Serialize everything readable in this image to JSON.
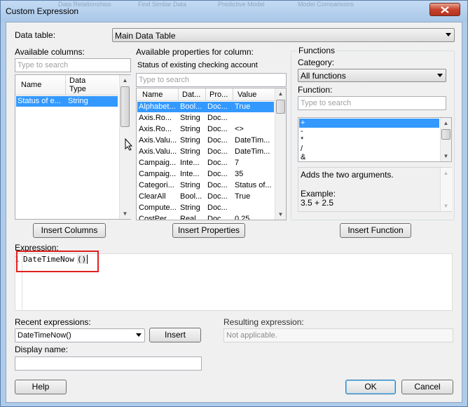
{
  "window": {
    "title": "Custom Expression",
    "ghost_menu_items": [
      "Data Relationships",
      "Find Similar Data",
      "Predictive Model",
      "Model Comparisons"
    ]
  },
  "data_table": {
    "label": "Data table:",
    "value": "Main Data Table"
  },
  "columns": {
    "label": "Available columns:",
    "search_placeholder": "Type to search",
    "headers": [
      "Name",
      "Data Type"
    ],
    "header_type_line1": "Data",
    "header_type_line2": "Type",
    "rows": [
      {
        "name": "Status of e...",
        "type": "String"
      }
    ],
    "insert_label": "Insert Columns"
  },
  "properties": {
    "label": "Available properties for column:",
    "column_name": "Status of existing checking account",
    "search_placeholder": "Type to search",
    "headers": [
      "Name",
      "Dat...",
      "Pro...",
      "Value"
    ],
    "rows": [
      [
        "Alphabet...",
        "Bool...",
        "Doc...",
        "True"
      ],
      [
        "Axis.Ro...",
        "String",
        "Doc...",
        ""
      ],
      [
        "Axis.Ro...",
        "String",
        "Doc...",
        "<>"
      ],
      [
        "Axis.Valu...",
        "String",
        "Doc...",
        "DateTim..."
      ],
      [
        "Axis.Valu...",
        "String",
        "Doc...",
        "DateTim..."
      ],
      [
        "Campaig...",
        "Inte...",
        "Doc...",
        "7"
      ],
      [
        "Campaig...",
        "Inte...",
        "Doc...",
        "35"
      ],
      [
        "Categori...",
        "String",
        "Doc...",
        "Status of..."
      ],
      [
        "ClearAll",
        "Bool...",
        "Doc...",
        "True"
      ],
      [
        "Compute...",
        "String",
        "Doc...",
        ""
      ],
      [
        "CostPer...",
        "Real",
        "Doc...",
        "0.25"
      ]
    ],
    "insert_label": "Insert Properties"
  },
  "functions": {
    "group_label": "Functions",
    "category_label": "Category:",
    "category_value": "All functions",
    "function_label": "Function:",
    "search_placeholder": "Type to search",
    "items": [
      "+",
      "-",
      "*",
      "/",
      "&"
    ],
    "description": "Adds the two arguments.",
    "example_label": "Example:",
    "example_value": "3.5 + 2.5",
    "insert_label": "Insert Function"
  },
  "expression": {
    "label": "Expression:",
    "line_number": "1",
    "func_name": "DateTimeNow",
    "parens": "()"
  },
  "recent": {
    "label": "Recent expressions:",
    "value": "DateTimeNow()",
    "insert_label": "Insert"
  },
  "resulting": {
    "label": "Resulting expression:",
    "value": "Not applicable."
  },
  "display_name": {
    "label": "Display name:",
    "value": ""
  },
  "buttons": {
    "help": "Help",
    "ok": "OK",
    "cancel": "Cancel"
  }
}
